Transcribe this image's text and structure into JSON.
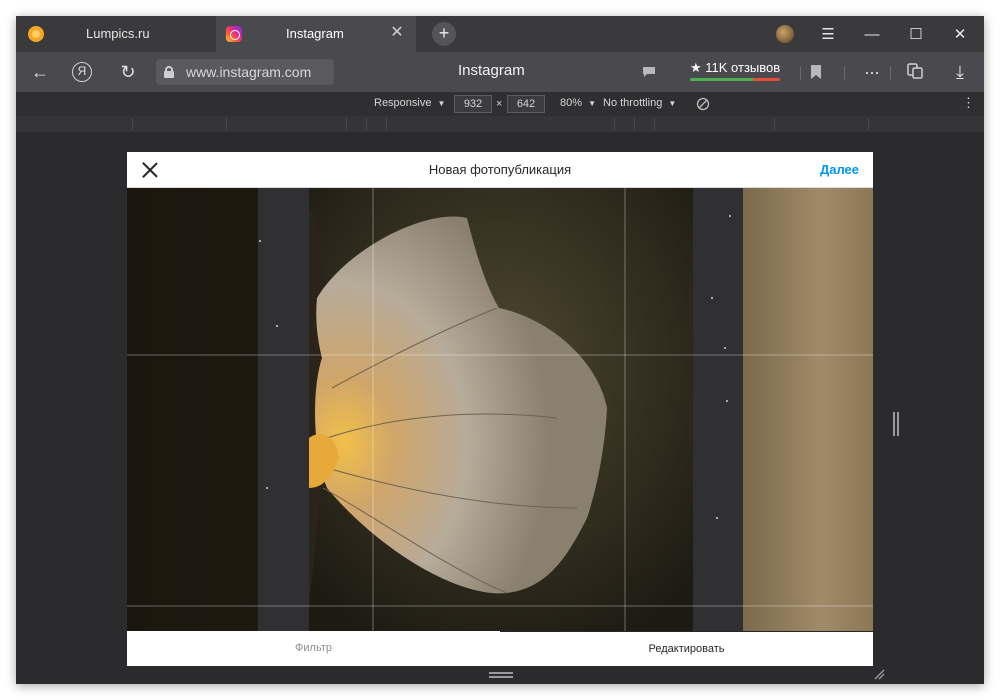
{
  "browser": {
    "tabs": [
      {
        "label": "Lumpics.ru",
        "active": false,
        "icon": "orange-circle-icon"
      },
      {
        "label": "Instagram",
        "active": true,
        "icon": "instagram-icon"
      }
    ],
    "close_tab": "✕",
    "new_tab": "+",
    "window_controls": {
      "menu": "☰",
      "minimize": "—",
      "maximize": "☐",
      "close": "✕"
    },
    "url": "www.instagram.com",
    "page_title": "Instagram",
    "reviews_label": "★ 11K отзывов",
    "more": "...",
    "icons": {
      "back": "←",
      "yandex": "Я",
      "reload": "↻",
      "download": "⤓",
      "bookmark": "🔖"
    }
  },
  "devtools": {
    "device": "Responsive",
    "width": "932",
    "times": "×",
    "height": "642",
    "zoom": "80%",
    "throttling": "No throttling",
    "dropdown_arrow": "▼",
    "more_menu": "⋮"
  },
  "modal": {
    "title": "Новая фотопубликация",
    "next_label": "Далее",
    "footer": {
      "filter_label": "Фильтр",
      "edit_label": "Редактировать",
      "active_tab": "edit"
    }
  },
  "colors": {
    "accent_blue": "#0095f6",
    "browser_dark": "#2b2b2e",
    "tab_active": "#4a4a4e"
  }
}
